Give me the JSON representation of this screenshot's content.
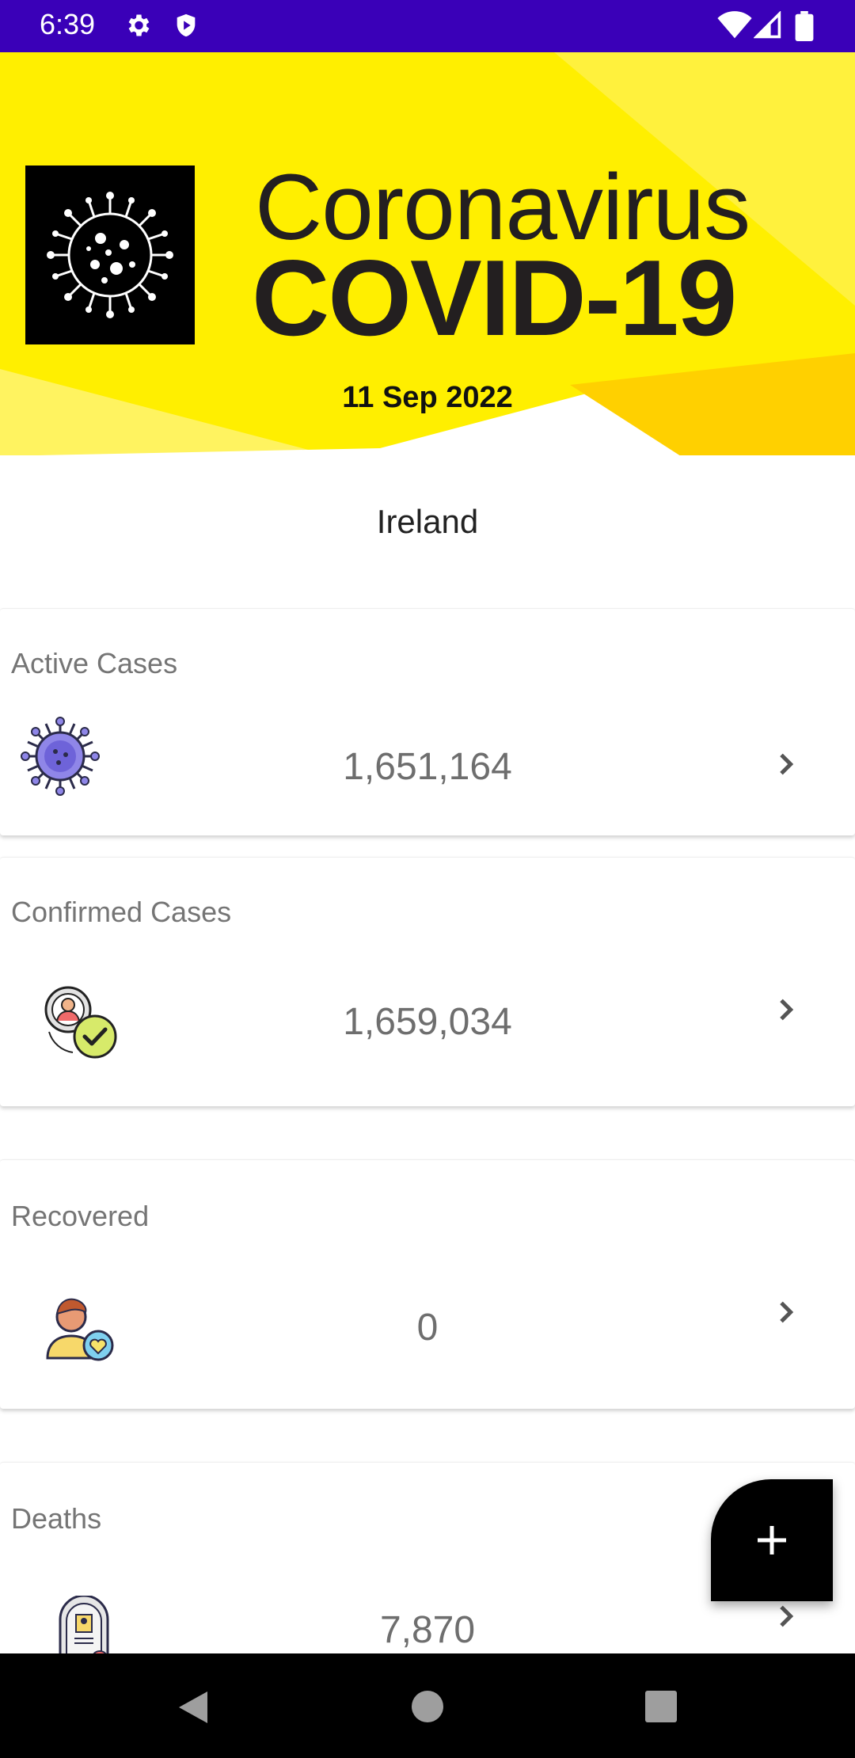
{
  "status_bar": {
    "time": "6:39",
    "icons": [
      "settings-icon",
      "shield-icon",
      "wifi-icon",
      "signal-icon",
      "battery-icon"
    ],
    "background": "#3a00b8"
  },
  "banner": {
    "title_line1": "Coronavirus",
    "title_line2": "COVID-19",
    "date": "11 Sep 2022",
    "background": "#ffef00"
  },
  "country": "Ireland",
  "cards": [
    {
      "label": "Active Cases",
      "value": "1,651,164",
      "icon": "virus-icon"
    },
    {
      "label": "Confirmed Cases",
      "value": "1,659,034",
      "icon": "confirmed-person-icon"
    },
    {
      "label": "Recovered",
      "value": "0",
      "icon": "recovered-person-icon"
    },
    {
      "label": "Deaths",
      "value": "7,870",
      "icon": "tombstone-icon"
    }
  ],
  "fab": {
    "icon": "plus-icon"
  },
  "nav_bar": {
    "icons": [
      "back-icon",
      "home-icon",
      "recents-icon"
    ]
  }
}
